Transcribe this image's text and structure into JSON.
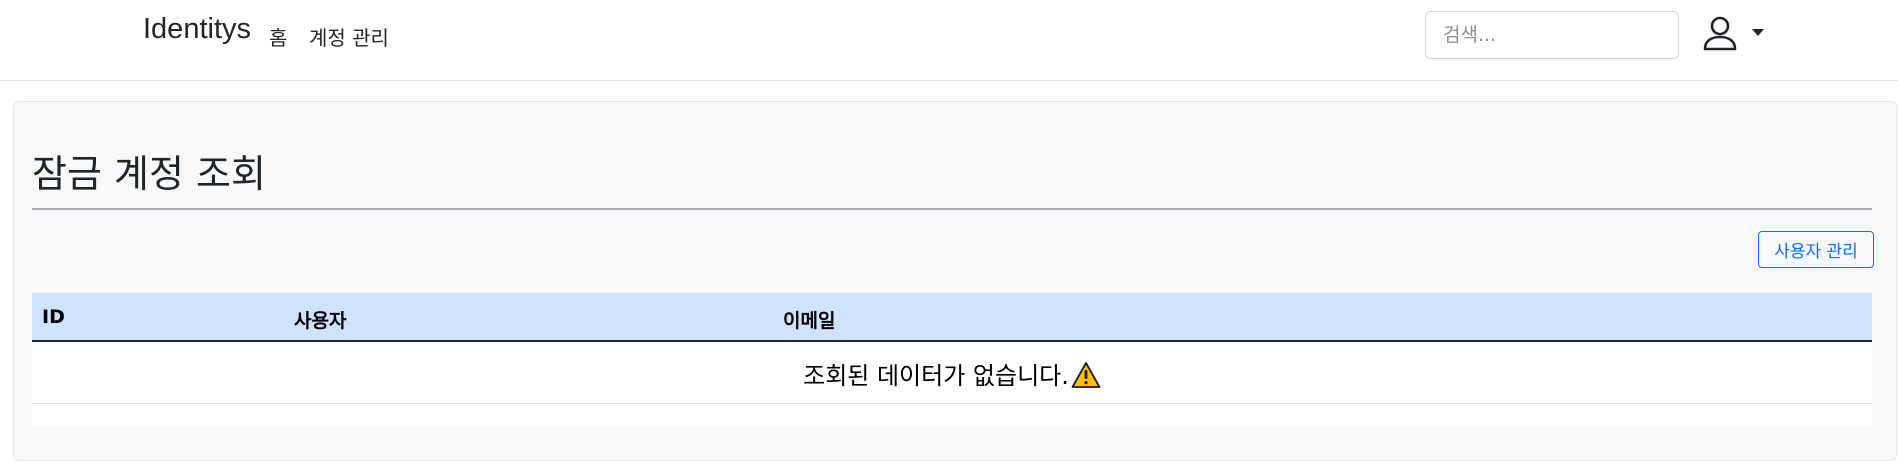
{
  "navbar": {
    "brand": "Identitys",
    "links": [
      {
        "label": "홈"
      },
      {
        "label": "계정 관리"
      }
    ],
    "search": {
      "placeholder": "검색...",
      "value": ""
    },
    "user_icon": "person-icon",
    "caret_icon": "caret-down-icon"
  },
  "main": {
    "title": "잠금 계정 조회",
    "manage_users_button": "사용자 관리",
    "table": {
      "columns": [
        "ID",
        "사용자",
        "이메일"
      ],
      "rows": [],
      "empty_message": "조회된 데이터가 없습니다.",
      "empty_icon": "warning-icon"
    }
  },
  "colors": {
    "accent": "#0d6efd",
    "table_header_bg": "#cfe2ff",
    "panel_bg": "#f8f9fa",
    "warning": "#ffc107"
  }
}
